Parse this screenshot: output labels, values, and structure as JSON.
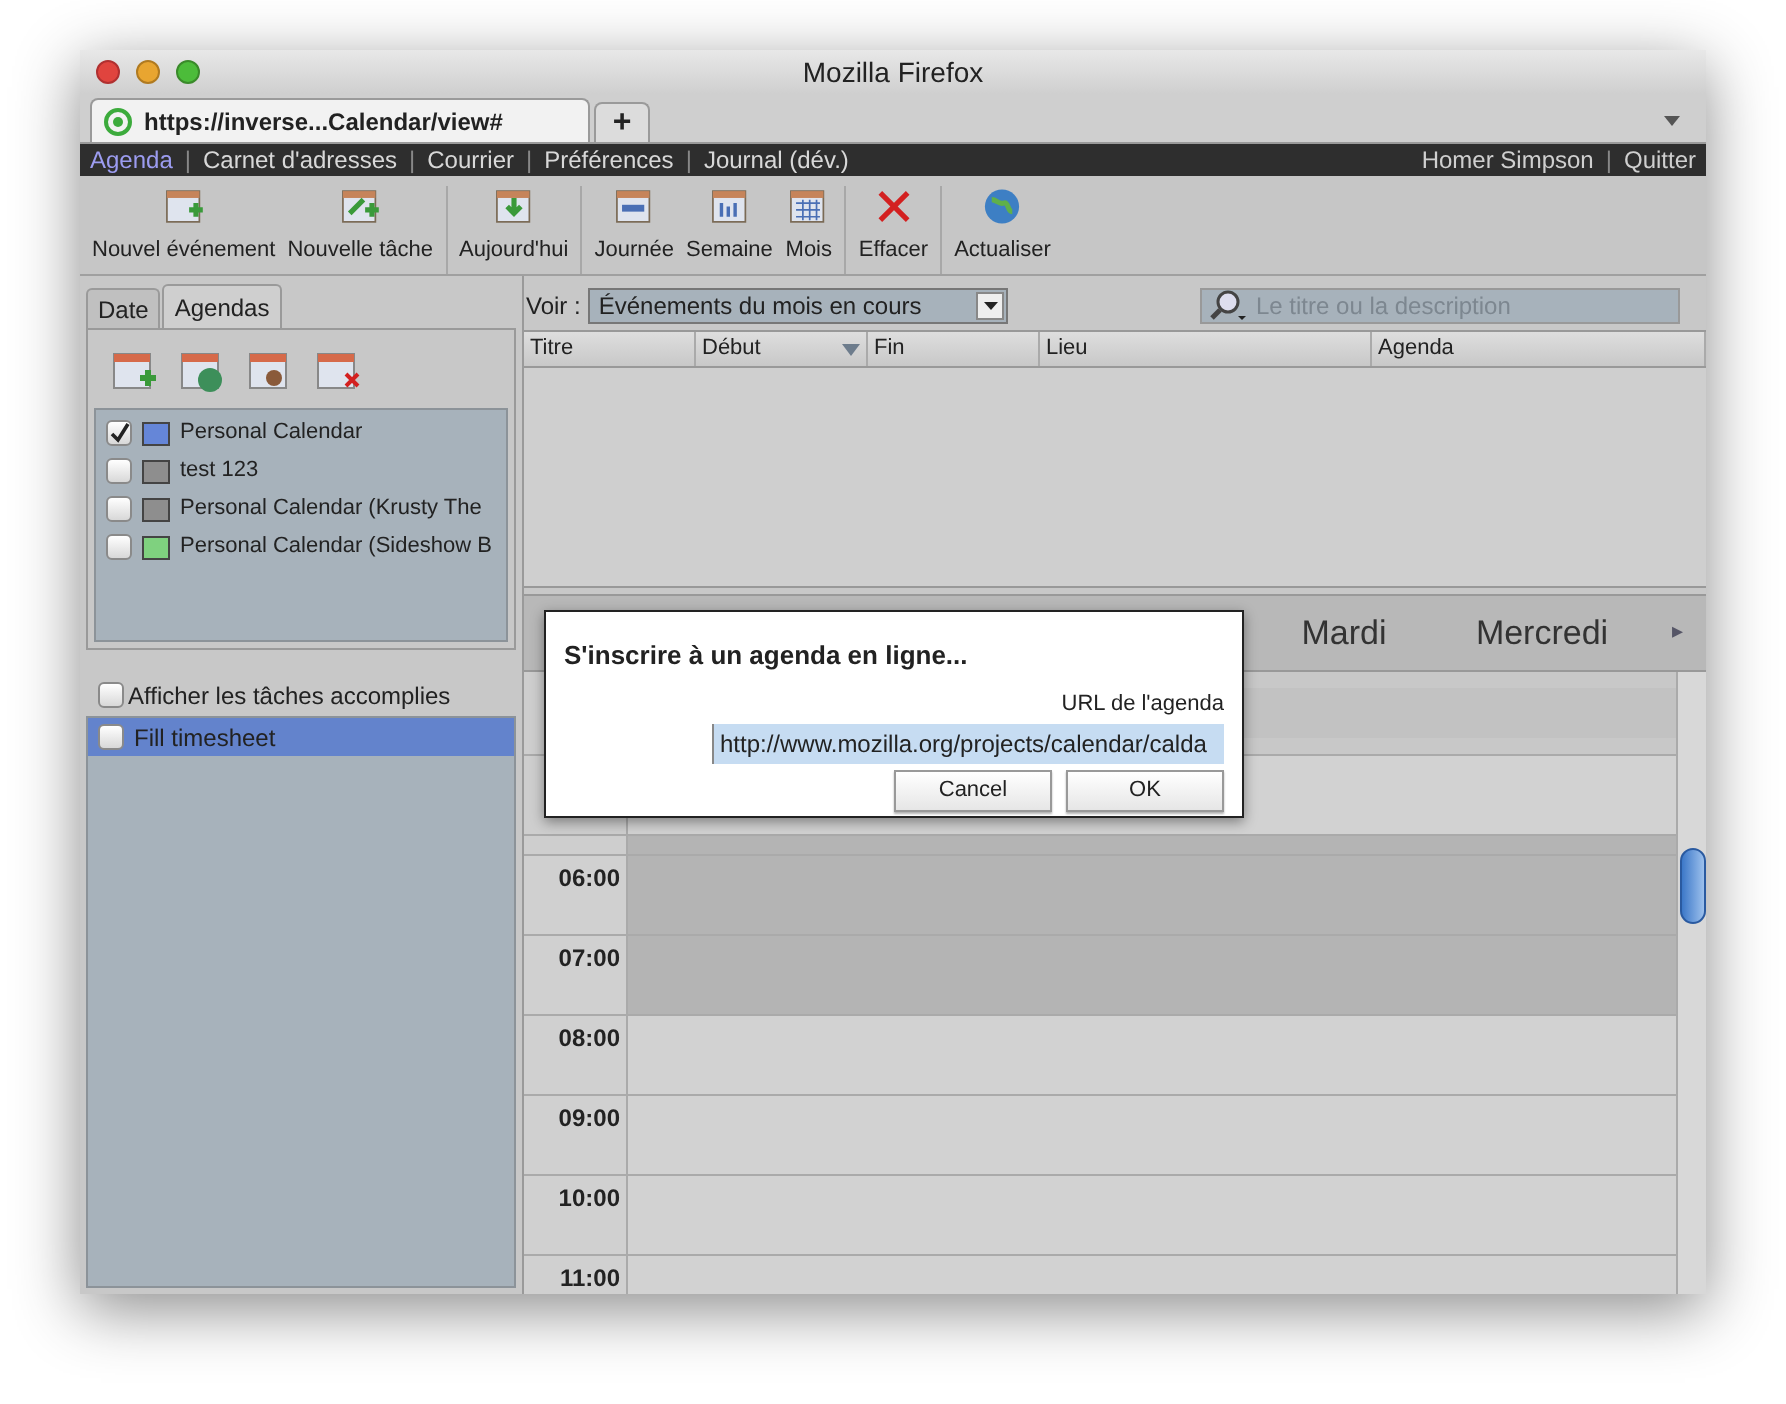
{
  "window": {
    "title": "Mozilla Firefox"
  },
  "browser_tabs": [
    {
      "label": "https://inverse...Calendar/view#",
      "selected": true
    }
  ],
  "new_tab_symbol": "+",
  "nav": {
    "links": [
      {
        "label": "Agenda",
        "selected": true
      },
      {
        "separator": "|",
        "label": "Carnet d'adresses",
        "selected": false
      },
      {
        "separator": "|",
        "label": "Courrier",
        "selected": false
      },
      {
        "separator": "|",
        "label": "Préférences",
        "selected": false
      },
      {
        "separator": "|",
        "label": "Journal (dév.)",
        "selected": false
      }
    ],
    "user": "Homer Simpson",
    "user_separator": "|",
    "logout": "Quitter"
  },
  "toolbar": [
    [
      {
        "kind": "new-event",
        "label": "Nouvel événement"
      },
      {
        "kind": "new-task",
        "label": "Nouvelle tâche"
      }
    ],
    [
      {
        "kind": "today",
        "label": "Aujourd'hui"
      }
    ],
    [
      {
        "kind": "day",
        "label": "Journée"
      },
      {
        "kind": "week",
        "label": "Semaine"
      },
      {
        "kind": "month",
        "label": "Mois"
      }
    ],
    [
      {
        "kind": "delete",
        "label": "Effacer"
      }
    ],
    [
      {
        "kind": "refresh",
        "label": "Actualiser"
      }
    ]
  ],
  "sidebar": {
    "tabs": [
      {
        "label": "Date",
        "selected": false
      },
      {
        "label": "Agendas",
        "selected": true
      }
    ],
    "calendar_tools": [
      {
        "kind": "add"
      },
      {
        "kind": "web"
      },
      {
        "kind": "user"
      },
      {
        "kind": "remove"
      }
    ],
    "calendars": [
      {
        "name": "Personal Calendar",
        "checked": true,
        "color": "#6586d8"
      },
      {
        "name": "test 123",
        "checked": false,
        "color": "#8e8e8e"
      },
      {
        "name": "Personal Calendar (Krusty The",
        "checked": false,
        "color": "#8e8e8e"
      },
      {
        "name": "Personal Calendar (Sideshow B",
        "checked": false,
        "color": "#7fd17f"
      }
    ],
    "show_completed": {
      "label": "Afficher les tâches accomplies",
      "checked": false
    },
    "tasks": [
      {
        "name": "Fill timesheet",
        "checked": false,
        "selected": true
      }
    ]
  },
  "filter": {
    "label": "Voir :",
    "value": "Événements du mois en cours",
    "search_placeholder": "Le titre ou la description"
  },
  "table": {
    "columns": [
      {
        "label": "Titre",
        "sorted": false
      },
      {
        "label": "Début",
        "sorted": true
      },
      {
        "label": "Fin",
        "sorted": false
      },
      {
        "label": "Lieu",
        "sorted": false
      },
      {
        "label": "Agenda",
        "sorted": false
      }
    ]
  },
  "calendar": {
    "days": [
      "Mardi",
      "Mercredi"
    ],
    "next_symbol": "▸",
    "hours": [
      {
        "label": "06:00",
        "shaded": true
      },
      {
        "label": "07:00",
        "shaded": true
      },
      {
        "label": "08:00",
        "shaded": false
      },
      {
        "label": "09:00",
        "shaded": false
      },
      {
        "label": "10:00",
        "shaded": false
      },
      {
        "label": "11:00",
        "shaded": false
      }
    ]
  },
  "dialog": {
    "title": "S'inscrire à un agenda en ligne...",
    "field_label": "URL de l'agenda",
    "url": "http://www.mozilla.org/projects/calendar/calda",
    "buttons": [
      "Cancel",
      "OK"
    ]
  }
}
